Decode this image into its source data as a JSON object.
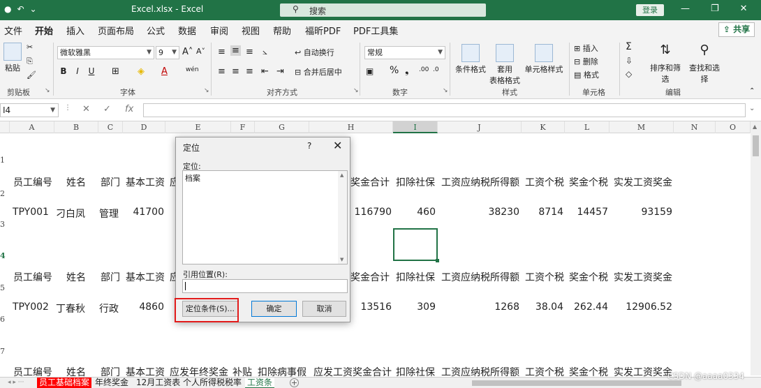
{
  "window": {
    "filename": "Excel.xlsx",
    "app": "Excel",
    "search_placeholder": "搜索",
    "login": "登录"
  },
  "ribbon_tabs": [
    "文件",
    "开始",
    "插入",
    "页面布局",
    "公式",
    "数据",
    "审阅",
    "视图",
    "帮助",
    "福昕PDF",
    "PDF工具集"
  ],
  "share": "共享",
  "ribbon": {
    "clipboard": {
      "paste": "粘贴",
      "label": "剪贴板"
    },
    "font": {
      "name": "微软雅黑",
      "size": "9",
      "label": "字体",
      "buttons": [
        "B",
        "I",
        "U"
      ]
    },
    "align": {
      "wrap": "自动换行",
      "merge": "合并后居中",
      "label": "对齐方式"
    },
    "number": {
      "format": "常规",
      "label": "数字"
    },
    "styles": {
      "cond": "条件格式",
      "table1": "套用",
      "table2": "表格格式",
      "cellstyle": "单元格样式",
      "label": "样式"
    },
    "cells": {
      "insert": "插入",
      "delete": "删除",
      "format": "格式",
      "label": "单元格"
    },
    "edit": {
      "sort": "排序和筛选",
      "find": "查找和选择",
      "label": "编辑"
    }
  },
  "formula_bar": {
    "name_box": "I4",
    "fx": "fx"
  },
  "columns": [
    "A",
    "B",
    "C",
    "D",
    "E",
    "F",
    "G",
    "H",
    "I",
    "J",
    "K",
    "L",
    "M",
    "N",
    "O"
  ],
  "rows": [
    "1",
    "2",
    "3",
    "4",
    "5",
    "6",
    "7"
  ],
  "grid": {
    "header_a": [
      "员工编号",
      "姓名",
      "部门",
      "基本工资",
      "应",
      "奖金合计",
      "扣除社保",
      "工资应纳税所得额",
      "工资个税",
      "奖金个税",
      "实发工资奖金"
    ],
    "row_a": [
      "TPY001",
      "刁白凤",
      "管理",
      "41700",
      "116790",
      "460",
      "38230",
      "8714",
      "14457",
      "93159"
    ],
    "header_b": [
      "员工编号",
      "姓名",
      "部门",
      "基本工资",
      "应",
      "奖金合计",
      "扣除社保",
      "工资应纳税所得额",
      "工资个税",
      "奖金个税",
      "实发工资奖金"
    ],
    "row_b": [
      "TPY002",
      "丁春秋",
      "行政",
      "4860",
      "13516",
      "309",
      "1268",
      "38.04",
      "262.44",
      "12906.52"
    ],
    "header_c": [
      "员工编号",
      "姓名",
      "部门",
      "基本工资",
      "应发年终奖金",
      "补贴",
      "扣除病事假",
      "应发工资奖金合计",
      "扣除社保",
      "工资应纳税所得额",
      "工资个税",
      "奖金个税",
      "实发工资奖金"
    ]
  },
  "dialog": {
    "title": "定位",
    "help": "?",
    "goto_label": "定位:",
    "list_item": "档案",
    "ref_label": "引用位置(R):",
    "special_btn": "定位条件(S)...",
    "ok_btn": "确定",
    "cancel_btn": "取消"
  },
  "sheets": [
    "员工基础档案",
    "年终奖金",
    "12月工资表",
    "个人所得税税率",
    "工资条"
  ],
  "watermark": "CSDN @aaaa0334",
  "colors": {
    "excel_green": "#217346",
    "highlight_red": "#e21a1a"
  }
}
